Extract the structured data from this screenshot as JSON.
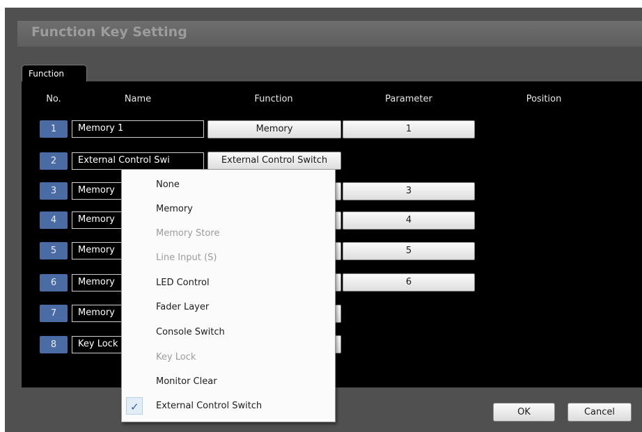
{
  "dialog": {
    "title": "Function Key Setting",
    "tab_label": "Function",
    "columns": {
      "no": "No.",
      "name": "Name",
      "function": "Function",
      "parameter": "Parameter",
      "position": "Position"
    },
    "rows": [
      {
        "no": "1",
        "name": "Memory 1",
        "function": "Memory",
        "parameter": "1"
      },
      {
        "no": "2",
        "name": "External Control Swi",
        "function": "External Control Switch",
        "parameter": ""
      },
      {
        "no": "3",
        "name": "Memory",
        "function": "",
        "parameter": "3"
      },
      {
        "no": "4",
        "name": "Memory",
        "function": "",
        "parameter": "4"
      },
      {
        "no": "5",
        "name": "Memory",
        "function": "",
        "parameter": "5"
      },
      {
        "no": "6",
        "name": "Memory",
        "function": "",
        "parameter": "6"
      },
      {
        "no": "7",
        "name": "Memory",
        "function": "",
        "parameter": ""
      },
      {
        "no": "8",
        "name": "Key Lock",
        "function": "",
        "parameter": ""
      }
    ],
    "ok_label": "OK",
    "cancel_label": "Cancel"
  },
  "menu": {
    "items": [
      {
        "label": "None",
        "enabled": true,
        "checked": false
      },
      {
        "label": "Memory",
        "enabled": true,
        "checked": false
      },
      {
        "label": "Memory Store",
        "enabled": false,
        "checked": false
      },
      {
        "label": "Line Input (S)",
        "enabled": false,
        "checked": false
      },
      {
        "label": "LED Control",
        "enabled": true,
        "checked": false
      },
      {
        "label": "Fader Layer",
        "enabled": true,
        "checked": false
      },
      {
        "label": "Console Switch",
        "enabled": true,
        "checked": false
      },
      {
        "label": "Key Lock",
        "enabled": false,
        "checked": false
      },
      {
        "label": "Monitor Clear",
        "enabled": true,
        "checked": false
      },
      {
        "label": "External Control Switch",
        "enabled": true,
        "checked": true
      }
    ],
    "check_glyph": "✓"
  },
  "colors": {
    "badge": "#4a6ba3",
    "panel": "#000000",
    "dialog": "#505050",
    "check": "#2a5fa8"
  }
}
